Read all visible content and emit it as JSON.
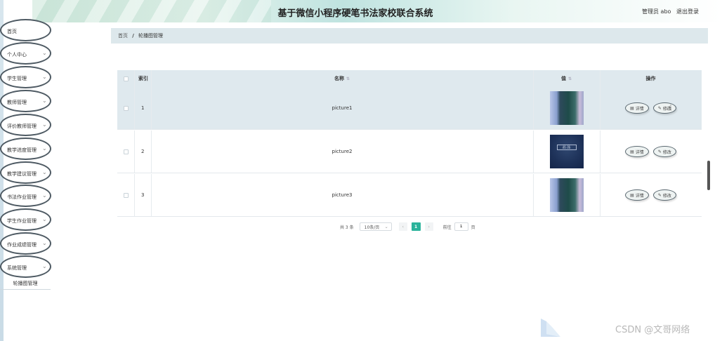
{
  "header": {
    "title": "基于微信小程序硬笔书法家校联合系统",
    "user": "管理员 abo",
    "logout": "退出登录"
  },
  "sidebar": {
    "items": [
      {
        "label": "首页",
        "has_children": false
      },
      {
        "label": "个人中心",
        "has_children": true
      },
      {
        "label": "学生管理",
        "has_children": true
      },
      {
        "label": "教师管理",
        "has_children": true
      },
      {
        "label": "评价教师管理",
        "has_children": true
      },
      {
        "label": "教学进度管理",
        "has_children": true
      },
      {
        "label": "教学建议管理",
        "has_children": true
      },
      {
        "label": "书法作业管理",
        "has_children": true
      },
      {
        "label": "学生作业管理",
        "has_children": true
      },
      {
        "label": "作业成绩管理",
        "has_children": true
      },
      {
        "label": "系统管理",
        "has_children": true
      }
    ],
    "submenu": "轮播图管理"
  },
  "breadcrumb": {
    "home": "首页",
    "separator": "/",
    "current": "轮播图管理"
  },
  "table": {
    "columns": {
      "index": "索引",
      "name": "名称",
      "value": "值",
      "actions": "操作"
    },
    "rows": [
      {
        "index": "1",
        "name": "picture1",
        "image": "blue-room",
        "highlight": true
      },
      {
        "index": "2",
        "name": "picture2",
        "image": "dark-poster",
        "highlight": false
      },
      {
        "index": "3",
        "name": "picture3",
        "image": "blue-room",
        "highlight": false
      }
    ],
    "detail_label": "详情",
    "edit_label": "修改",
    "dark_image_text": "品 品"
  },
  "pagination": {
    "total": "共 3 条",
    "page_size": "10条/页",
    "current_page": "1",
    "goto_label": "前往",
    "goto_value": "1",
    "page_unit": "页"
  },
  "watermark": "CSDN @文哥网络",
  "colors": {
    "accent": "#2bb39b",
    "header_bg": "#dfe9ee"
  }
}
